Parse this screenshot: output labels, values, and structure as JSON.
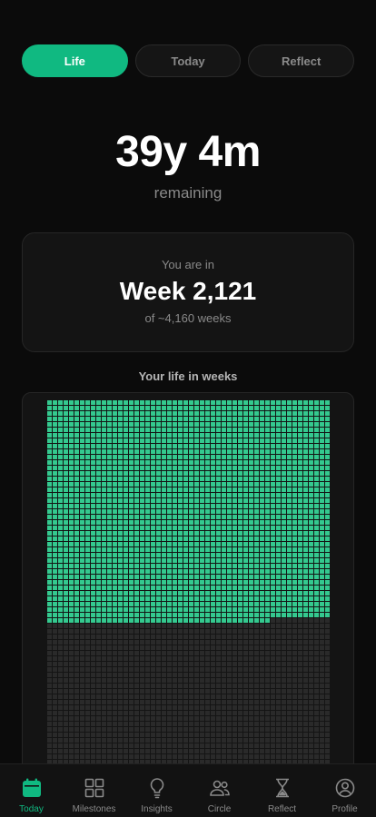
{
  "tabs": [
    {
      "label": "Life",
      "active": true
    },
    {
      "label": "Today",
      "active": false
    },
    {
      "label": "Reflect",
      "active": false
    }
  ],
  "remaining": {
    "value": "39y 4m",
    "label": "remaining"
  },
  "week_card": {
    "prefix": "You are in",
    "week": "Week 2,121",
    "total": "of ~4,160 weeks"
  },
  "grid": {
    "title": "Your life in weeks",
    "weeks_lived": 2121,
    "total_weeks": 4160,
    "weeks_per_row": 52,
    "lived_color": "#34c98f",
    "remaining_color": "#2a2a2a"
  },
  "nav": [
    {
      "icon": "calendar-icon",
      "label": "Today",
      "active": true
    },
    {
      "icon": "grid-icon",
      "label": "Milestones",
      "active": false
    },
    {
      "icon": "lightbulb-icon",
      "label": "Insights",
      "active": false
    },
    {
      "icon": "people-icon",
      "label": "Circle",
      "active": false
    },
    {
      "icon": "hourglass-icon",
      "label": "Reflect",
      "active": false
    },
    {
      "icon": "profile-icon",
      "label": "Profile",
      "active": false
    }
  ]
}
